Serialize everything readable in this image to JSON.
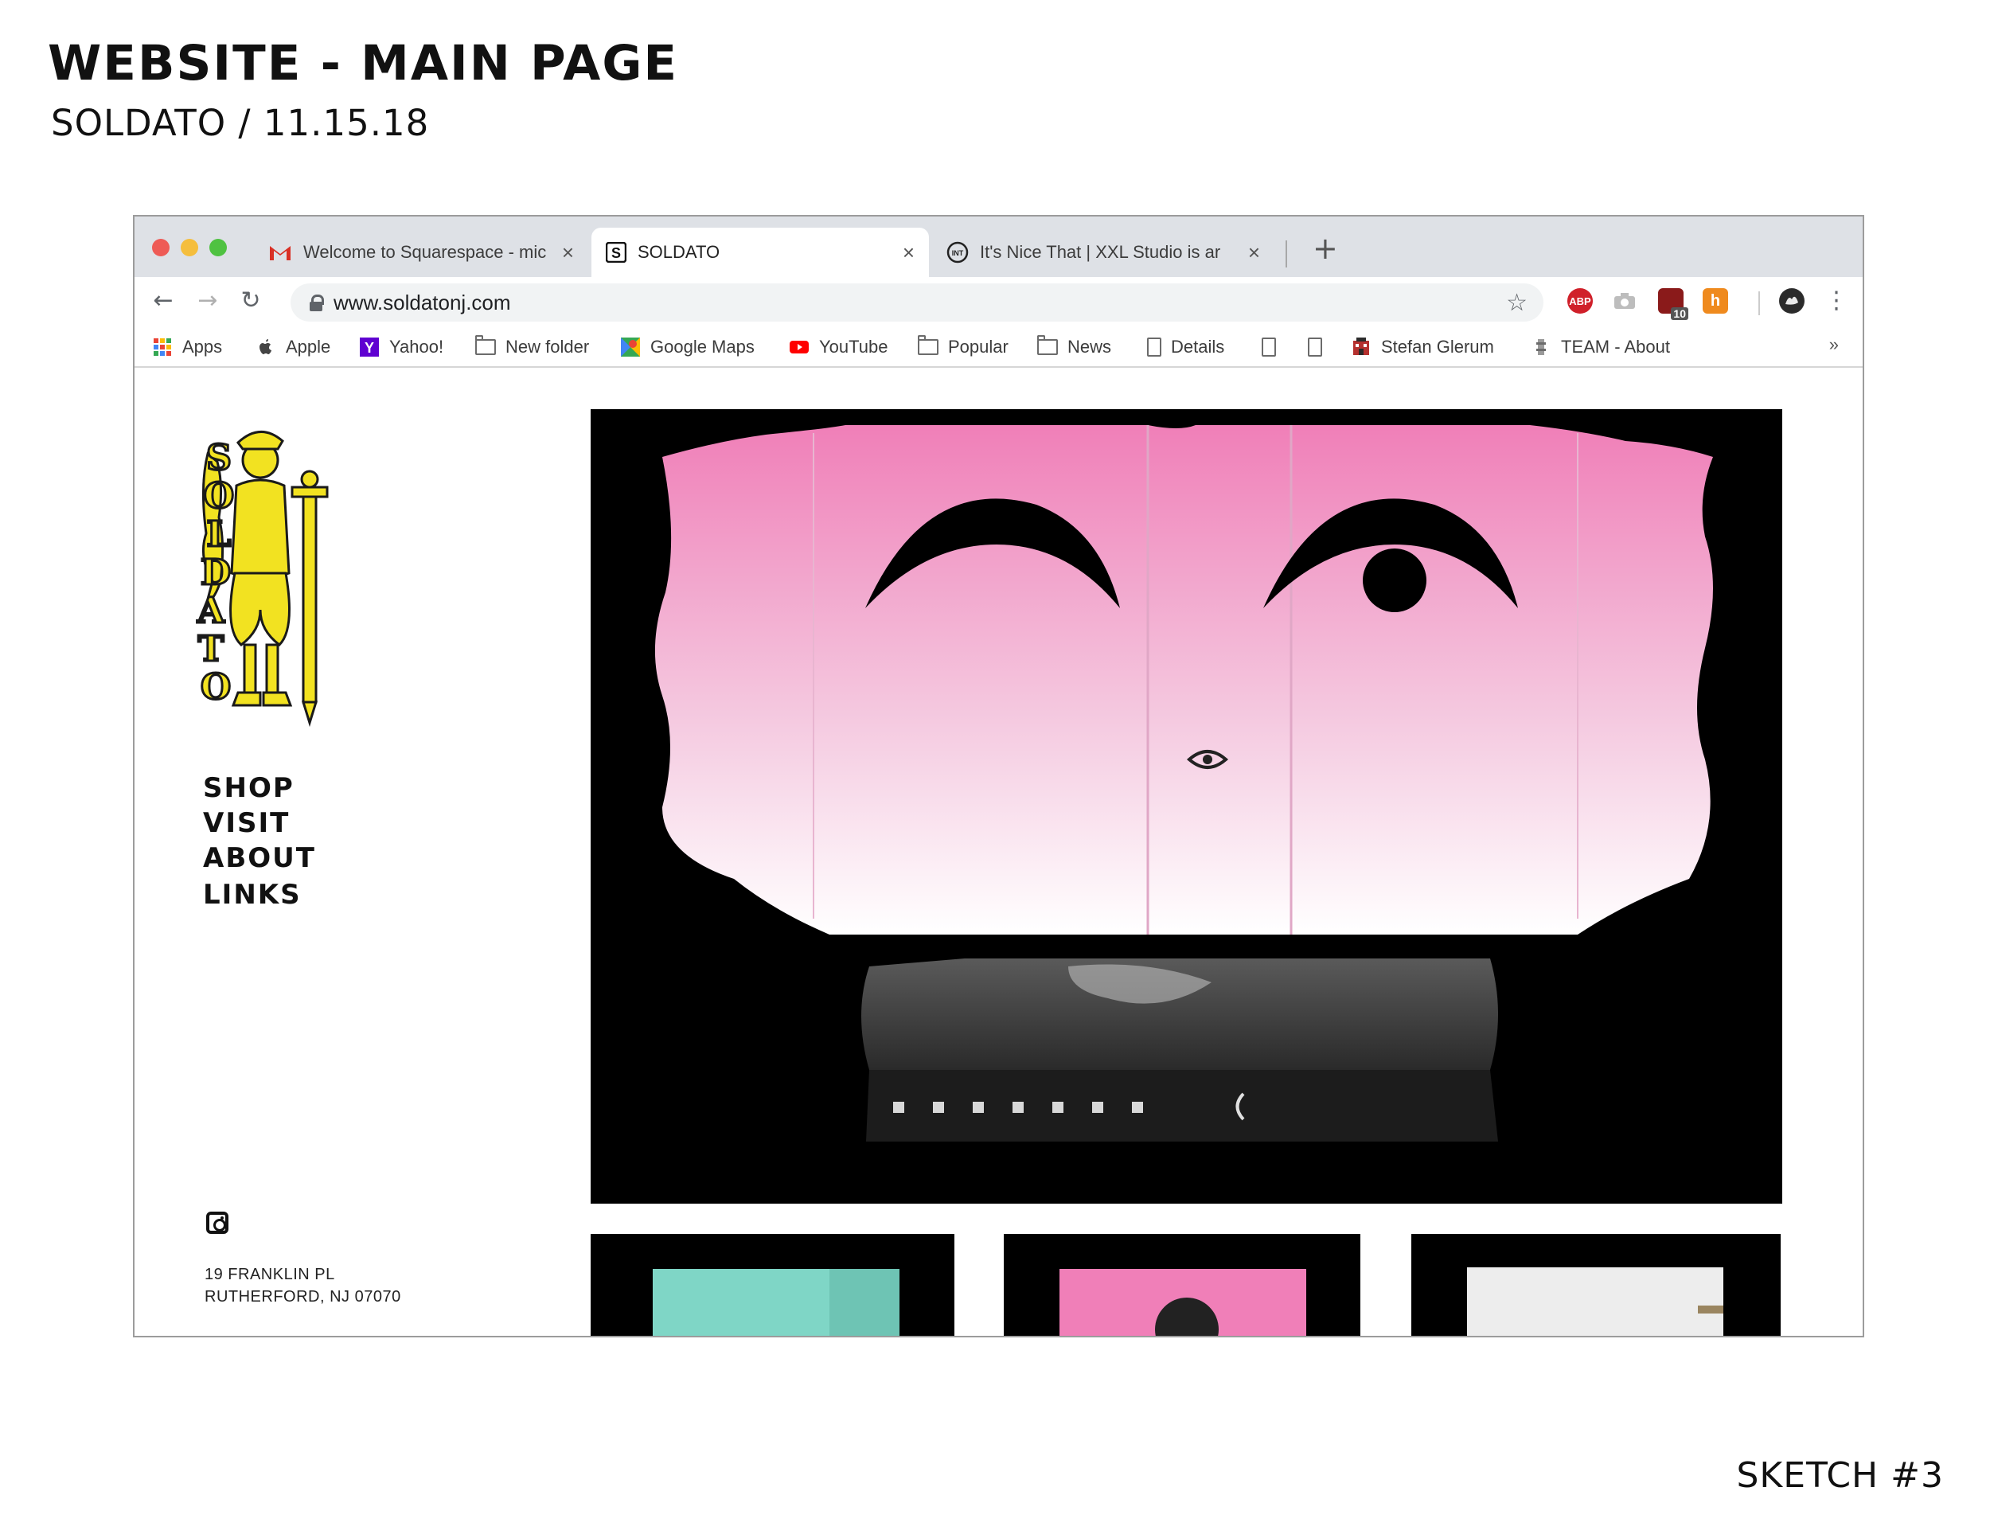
{
  "sheet": {
    "title": "WEBSITE - MAIN PAGE",
    "subtitle": "SOLDATO / 11.15.18",
    "sketch_label": "SKETCH #3"
  },
  "browser": {
    "tabs": [
      {
        "label": "Welcome to Squarespace - mic",
        "icon": "gmail-icon",
        "active": false
      },
      {
        "label": "SOLDATO",
        "icon": "squarespace-icon",
        "active": true
      },
      {
        "label": "It's Nice That | XXL Studio is ar",
        "icon": "itsnicethat-icon",
        "active": false
      }
    ],
    "tab_close": "×",
    "new_tab": "+",
    "url": "www.soldatonj.com",
    "extensions": [
      {
        "name": "adblock-plus-icon",
        "label": "ABP",
        "color": "#d0202a"
      },
      {
        "name": "camera-icon",
        "label": "",
        "color": "#bdbdbd"
      },
      {
        "name": "ublock-icon",
        "label": "10",
        "color": "#8a1a1a"
      },
      {
        "name": "hypothesis-icon",
        "label": "h",
        "color": "#ef8a1e"
      }
    ],
    "bookmarks": [
      {
        "label": "Apps",
        "icon": "apps-grid-icon"
      },
      {
        "label": "Apple",
        "icon": "apple-icon"
      },
      {
        "label": "Yahoo!",
        "icon": "yahoo-icon"
      },
      {
        "label": "New folder",
        "icon": "folder-icon"
      },
      {
        "label": "Google Maps",
        "icon": "google-maps-icon"
      },
      {
        "label": "YouTube",
        "icon": "youtube-icon"
      },
      {
        "label": "Popular",
        "icon": "folder-icon"
      },
      {
        "label": "News",
        "icon": "folder-icon"
      },
      {
        "label": "Details",
        "icon": "page-icon"
      },
      {
        "label": "",
        "icon": "page-icon"
      },
      {
        "label": "",
        "icon": "page-icon"
      },
      {
        "label": "Stefan Glerum",
        "icon": "stefan-icon"
      },
      {
        "label": "TEAM - About",
        "icon": "team-icon"
      }
    ],
    "bookmarks_more": "»"
  },
  "site": {
    "nav": [
      "SHOP",
      "VISIT",
      "ABOUT",
      "LINKS"
    ],
    "address_line1": "19 FRANKLIN PL",
    "address_line2": "RUTHERFORD, NJ 07070",
    "accent": "#f2e221"
  }
}
